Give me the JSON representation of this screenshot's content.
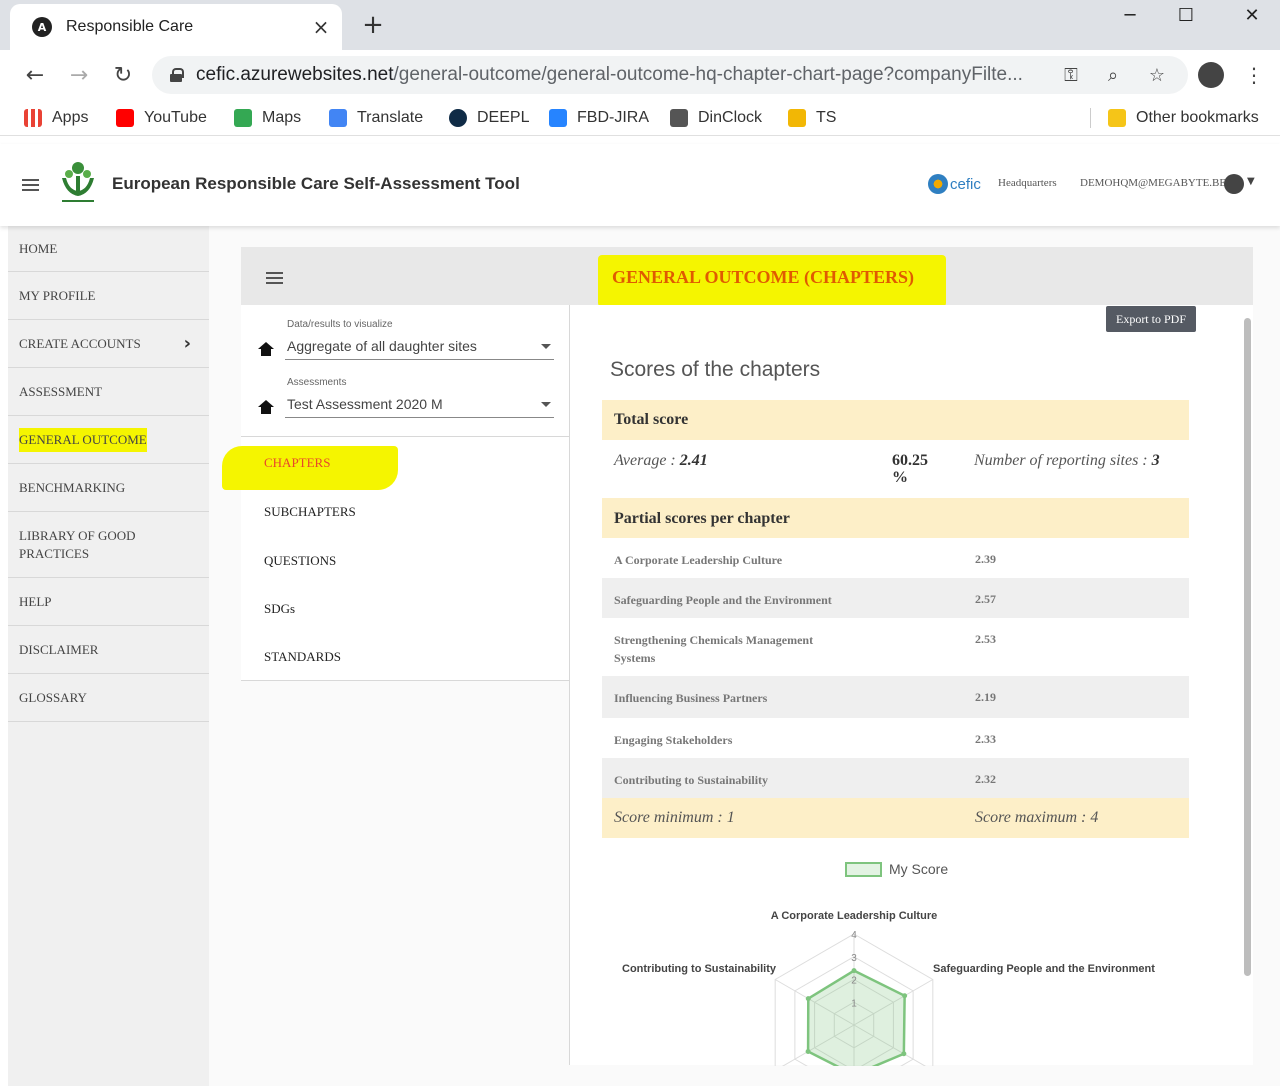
{
  "browser": {
    "tab_title": "Responsible Care",
    "tab_favicon": "A",
    "tab_close": "×",
    "new_tab": "+",
    "url_host": "cefic.azurewebsites.net",
    "url_path": "/general-outcome/general-outcome-hq-chapter-chart-page?companyFilte...",
    "bookmarks": [
      {
        "label": "Apps",
        "icon": "apps-grid-icon",
        "color": "#e94235"
      },
      {
        "label": "YouTube",
        "icon": "youtube-icon",
        "color": "#ff0000"
      },
      {
        "label": "Maps",
        "icon": "maps-icon",
        "color": "#34a853"
      },
      {
        "label": "Translate",
        "icon": "translate-icon",
        "color": "#4285f4"
      },
      {
        "label": "DEEPL",
        "icon": "deepl-icon",
        "color": "#0f2b46"
      },
      {
        "label": "FBD-JIRA",
        "icon": "jira-icon",
        "color": "#2684ff"
      },
      {
        "label": "DinClock",
        "icon": "hourglass-icon",
        "color": "#555555"
      },
      {
        "label": "TS",
        "icon": "ts-icon",
        "color": "#f2b705"
      }
    ],
    "other_bookmarks": "Other bookmarks"
  },
  "header": {
    "app_title": "European Responsible Care Self-Assessment Tool",
    "cefic": "cefic",
    "role": "Headquarters",
    "user_email": "DEMOHQM@MEGABYTE.BE"
  },
  "sidebar": {
    "items": [
      {
        "label": "HOME"
      },
      {
        "label": "MY PROFILE"
      },
      {
        "label": "CREATE ACCOUNTS"
      },
      {
        "label": "ASSESSMENT"
      },
      {
        "label": "GENERAL OUTCOME"
      },
      {
        "label": "BENCHMARKING"
      },
      {
        "label": "LIBRARY OF GOOD PRACTICES"
      },
      {
        "label": "HELP"
      },
      {
        "label": "DISCLAIMER"
      },
      {
        "label": "GLOSSARY"
      }
    ]
  },
  "page": {
    "title": "GENERAL OUTCOME (CHAPTERS)",
    "filters": {
      "data_label": "Data/results to visualize",
      "data_value": "Aggregate of all daughter sites",
      "assessment_label": "Assessments",
      "assessment_value": "Test Assessment 2020 M"
    },
    "nav": [
      "CHAPTERS",
      "SUBCHAPTERS",
      "QUESTIONS",
      "SDGs",
      "STANDARDS"
    ],
    "export_label": "Export to PDF",
    "scores_title": "Scores of the chapters",
    "total_score_label": "Total score",
    "average_label": "Average : ",
    "average_value": "2.41",
    "percent_value": "60.25",
    "percent_unit": "%",
    "reporting_label": "Number of reporting sites : ",
    "reporting_value": "3",
    "partial_label": "Partial scores per chapter",
    "chapters": [
      {
        "name": "A Corporate Leadership Culture",
        "score": "2.39"
      },
      {
        "name": "Safeguarding People and the Environment",
        "score": "2.57"
      },
      {
        "name": "Strengthening Chemicals Management Systems",
        "score": "2.53"
      },
      {
        "name": "Influencing Business Partners",
        "score": "2.19"
      },
      {
        "name": "Engaging Stakeholders",
        "score": "2.33"
      },
      {
        "name": "Contributing to Sustainability",
        "score": "2.32"
      }
    ],
    "score_min": "Score minimum : 1",
    "score_max": "Score maximum : 4"
  },
  "chart_data": {
    "type": "radar",
    "legend": "My Score",
    "series_color": "#7ec47e",
    "axes": [
      "A Corporate Leadership Culture",
      "Safeguarding People and the Environment",
      "Strengthening Chemicals Management Systems",
      "Influencing Business Partners",
      "Engaging Stakeholders",
      "Contributing to Sustainability"
    ],
    "values": [
      2.39,
      2.57,
      2.53,
      2.19,
      2.33,
      2.32
    ],
    "ticks": [
      "1",
      "2",
      "3",
      "4"
    ],
    "rmin": 0,
    "rmax": 4
  }
}
